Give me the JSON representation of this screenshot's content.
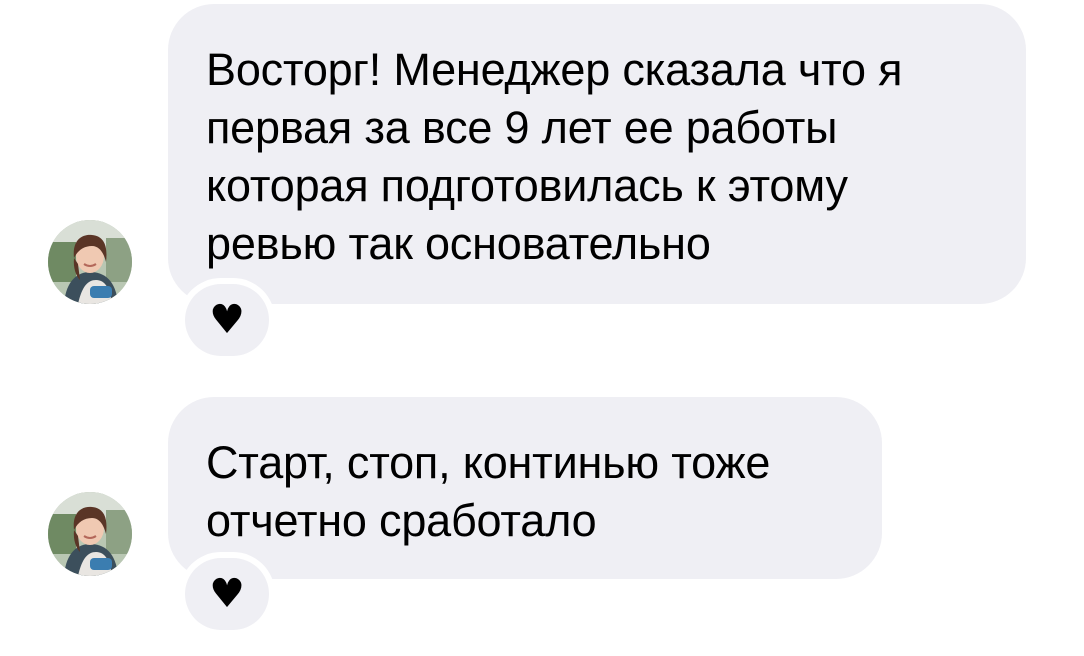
{
  "messages": [
    {
      "lines": [
        "Восторг! Менеджер сказала что я",
        "первая за все 9 лет ее работы",
        "которая подготовилась к этому",
        "ревью так основательно"
      ],
      "reaction": "♥"
    },
    {
      "lines": [
        "Старт, стоп, континью тоже",
        "отчетно сработало"
      ],
      "reaction": "♥"
    }
  ],
  "colors": {
    "bubble_background": "#efeff4",
    "text": "#000000",
    "page_background": "#ffffff"
  },
  "icons": {
    "avatar": "user-avatar-photo",
    "reaction": "black-heart-icon"
  }
}
